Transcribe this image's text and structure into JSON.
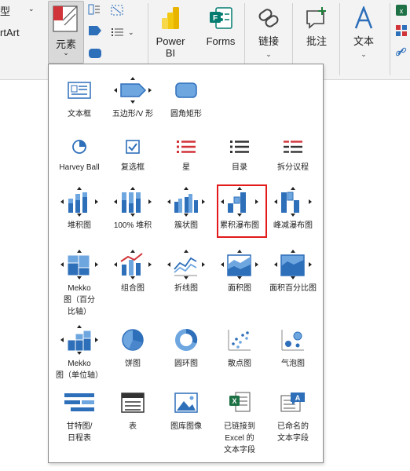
{
  "ribbon": {
    "partial_top_label": "型",
    "partial_wordart_label": "rtArt",
    "elements_label": "元素",
    "powerbi_label": "Power\nBI",
    "powerbi_line1": "Power",
    "powerbi_line2": "BI",
    "forms_label": "Forms",
    "link_label": "链接",
    "comment_label": "批注",
    "text_label": "文本"
  },
  "gallery": {
    "items": [
      {
        "label": "文本框"
      },
      {
        "label": "五边形/V 形"
      },
      {
        "label": "圆角矩形"
      },
      {
        "label": "Harvey Ball"
      },
      {
        "label": "复选框"
      },
      {
        "label": "星"
      },
      {
        "label": "目录"
      },
      {
        "label": "拆分议程"
      },
      {
        "label": "堆积图"
      },
      {
        "label": "100% 堆积"
      },
      {
        "label": "簇状图"
      },
      {
        "label": "累积瀑布图"
      },
      {
        "label": "峰减瀑布图"
      },
      {
        "label": "Mekko\n图（百分\n比轴）"
      },
      {
        "label": "组合图"
      },
      {
        "label": "折线图"
      },
      {
        "label": "面积图"
      },
      {
        "label": "面积百分比图"
      },
      {
        "label": "Mekko\n图（单位轴）"
      },
      {
        "label": "饼图"
      },
      {
        "label": "圆环图"
      },
      {
        "label": "散点图"
      },
      {
        "label": "气泡图"
      },
      {
        "label": "甘特图/\n日程表"
      },
      {
        "label": "表"
      },
      {
        "label": "图库图像"
      },
      {
        "label": "已链接到\nExcel 的\n文本字段"
      },
      {
        "label": "已命名的\n文本字段"
      }
    ]
  },
  "colors": {
    "accent_blue": "#2e6fba",
    "light_blue": "#6ea6e0",
    "red_highlight": "#e21a1a",
    "excel_green": "#1e7145",
    "forms_teal": "#037c6f",
    "powerbi_yellow": "#f2c811"
  }
}
